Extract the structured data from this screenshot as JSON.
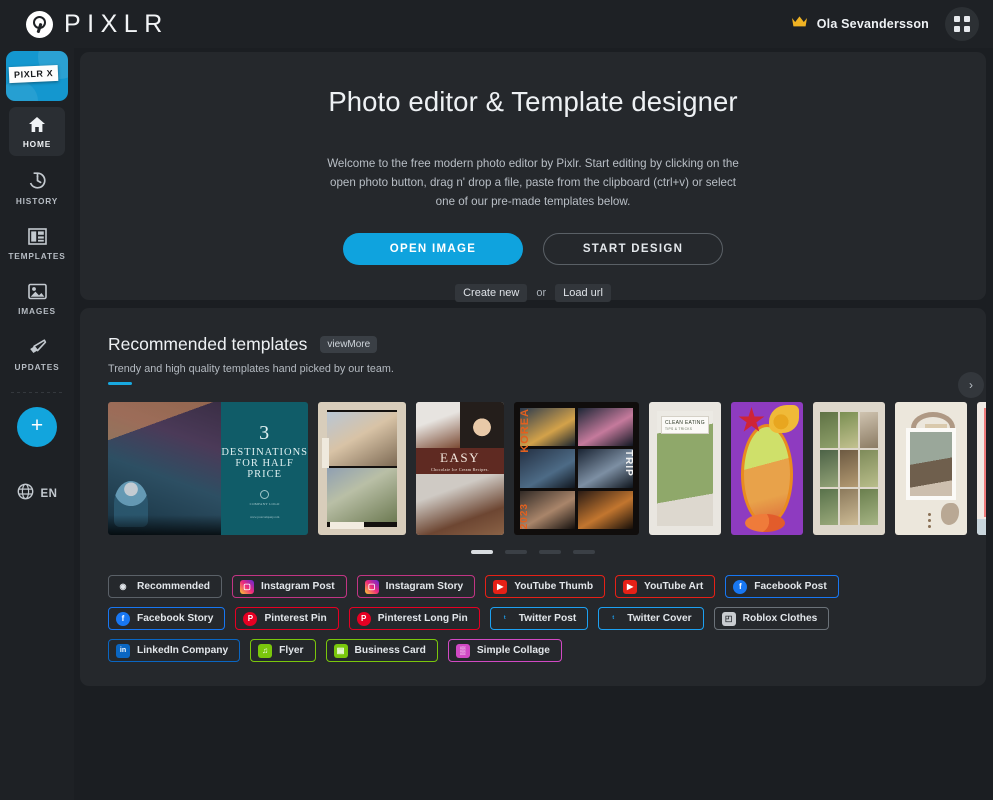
{
  "topbar": {
    "brand_name": "PIXLR",
    "user_name": "Ola Sevandersson",
    "crown_icon": "crown-icon",
    "apps_icon": "apps-grid-icon",
    "crown_color": "#f0b323"
  },
  "sidebar": {
    "banner_label": "PIXLR X",
    "items": [
      {
        "label": "HOME",
        "icon": "home-icon",
        "active": true
      },
      {
        "label": "HISTORY",
        "icon": "history-icon",
        "active": false
      },
      {
        "label": "TEMPLATES",
        "icon": "templates-icon",
        "active": false
      },
      {
        "label": "IMAGES",
        "icon": "images-icon",
        "active": false
      },
      {
        "label": "UPDATES",
        "icon": "megaphone-icon",
        "active": false
      }
    ],
    "add_label": "+",
    "language": "EN",
    "language_icon": "globe-icon"
  },
  "hero": {
    "title": "Photo editor & Template designer",
    "description": "Welcome to the free modern photo editor by Pixlr. Start editing by clicking on the open photo button, drag n' drop a file, paste from the clipboard (ctrl+v) or select one of our pre-made templates below.",
    "primary_button": "OPEN IMAGE",
    "secondary_button": "START DESIGN",
    "create_new": "Create new",
    "or": "or",
    "load_url": "Load url",
    "accent_color": "#18a9e0"
  },
  "templates": {
    "title": "Recommended templates",
    "view_more": "viewMore",
    "subtitle": "Trendy and high quality templates hand picked by our team.",
    "next_arrow": "›",
    "cards": [
      {
        "name": "travel-destinations",
        "num": "3",
        "l1": "DESTINATIONS",
        "l2": "FOR HALF",
        "l3": "PRICE",
        "tiny": "COMPANY LOGO",
        "tiny2": "www.yourcompany.com"
      },
      {
        "name": "film-strip-couple"
      },
      {
        "name": "easy-ice-cream-recipes",
        "band_title": "EASY",
        "band_sub": "Chocolate Ice Cream Recipes."
      },
      {
        "name": "korea-trip-collage",
        "vtitle": "KOREA",
        "vtrip": "TRIP",
        "vyear": "2023"
      },
      {
        "name": "clean-eating-tips",
        "label": "CLEAN EATING",
        "label_sub": "TIPS & TRICKS"
      },
      {
        "name": "purple-flower-portrait"
      },
      {
        "name": "paper-nine-grid-collage"
      },
      {
        "name": "coffee-moodboard"
      },
      {
        "name": "pink-frame-template"
      }
    ],
    "pagination": [
      {
        "active": true
      },
      {
        "active": false
      },
      {
        "active": false
      },
      {
        "active": false
      }
    ],
    "chips": [
      {
        "label": "Recommended",
        "icon": "eye-icon",
        "border": "#5b6168",
        "bg": "transparent",
        "glyph": "◉"
      },
      {
        "label": "Instagram Post",
        "icon": "instagram-icon",
        "border": "#c13584",
        "bg": "linear-gradient(45deg,#f9ce34,#ee2a7b,#6228d7)",
        "glyph": "▢"
      },
      {
        "label": "Instagram Story",
        "icon": "instagram-icon",
        "border": "#c13584",
        "bg": "linear-gradient(45deg,#f9ce34,#ee2a7b,#6228d7)",
        "glyph": "▢"
      },
      {
        "label": "YouTube Thumb",
        "icon": "youtube-icon",
        "border": "#e62117",
        "bg": "#e62117",
        "glyph": "▶"
      },
      {
        "label": "YouTube Art",
        "icon": "youtube-icon",
        "border": "#e62117",
        "bg": "#e62117",
        "glyph": "▶"
      },
      {
        "label": "Facebook Post",
        "icon": "facebook-icon",
        "border": "#1877f2",
        "bg": "#1877f2",
        "glyph": "f"
      },
      {
        "label": "Facebook Story",
        "icon": "facebook-icon",
        "border": "#1877f2",
        "bg": "#1877f2",
        "glyph": "f"
      },
      {
        "label": "Pinterest Pin",
        "icon": "pinterest-icon",
        "border": "#e60023",
        "bg": "#e60023",
        "glyph": "P"
      },
      {
        "label": "Pinterest Long Pin",
        "icon": "pinterest-icon",
        "border": "#e60023",
        "bg": "#e60023",
        "glyph": "P"
      },
      {
        "label": "Twitter Post",
        "icon": "twitter-icon",
        "border": "#1da1f2",
        "bg": "transparent",
        "glyph": "ᵗ"
      },
      {
        "label": "Twitter Cover",
        "icon": "twitter-icon",
        "border": "#1da1f2",
        "bg": "transparent",
        "glyph": "ᵗ"
      },
      {
        "label": "Roblox Clothes",
        "icon": "roblox-icon",
        "border": "#6b7279",
        "bg": "#c9ccd0",
        "glyph": "◰"
      },
      {
        "label": "LinkedIn Company",
        "icon": "linkedin-icon",
        "border": "#0a66c2",
        "bg": "#0a66c2",
        "glyph": "in"
      },
      {
        "label": "Flyer",
        "icon": "flyer-icon",
        "border": "#7ac70c",
        "bg": "#7ac70c",
        "glyph": "♫"
      },
      {
        "label": "Business Card",
        "icon": "business-card-icon",
        "border": "#7ac70c",
        "bg": "#7ac70c",
        "glyph": "▤"
      },
      {
        "label": "Simple Collage",
        "icon": "collage-icon",
        "border": "#d149c4",
        "bg": "#d149c4",
        "glyph": "▒"
      }
    ]
  }
}
